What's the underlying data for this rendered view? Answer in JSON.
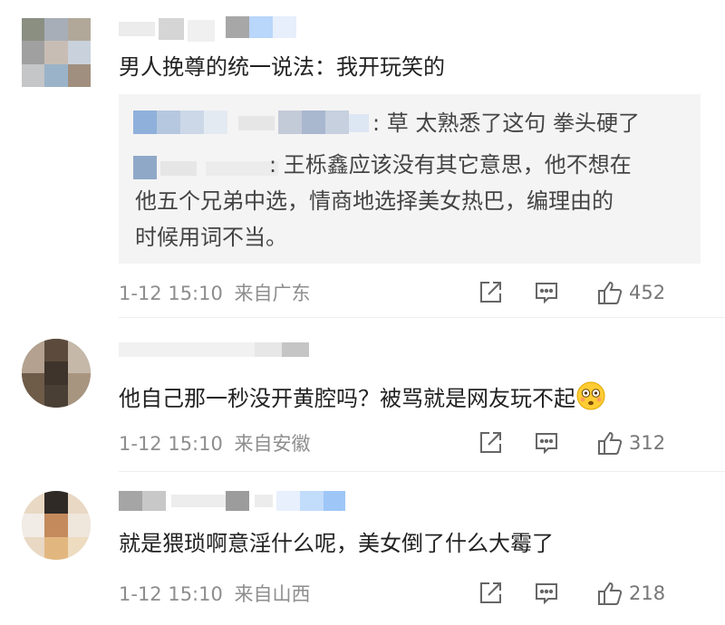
{
  "comments": [
    {
      "text": "男人挽尊的统一说法：我开玩笑的",
      "replies": [
        {
          "text": ": 草 太熟悉了这句 拳头硬了"
        },
        {
          "lines": [
            ": 王栎鑫应该没有其它意思，他不想在",
            "他五个兄弟中选，情商地选择美女热巴，编理由的",
            "时候用词不当。"
          ]
        }
      ],
      "time": "1-12 15:10",
      "location": "来自广东",
      "likes": "452"
    },
    {
      "text": "他自己那一秒没开黄腔吗？被骂就是网友玩不起",
      "emoji": "flushed-emoji",
      "time": "1-12 15:10",
      "location": "来自安徽",
      "likes": "312"
    },
    {
      "text": "就是猥琐啊意淫什么呢，美女倒了什么大霉了",
      "time": "1-12 15:10",
      "location": "来自山西",
      "likes": "218"
    }
  ],
  "icons": {
    "share": "share-icon",
    "comment": "comment-icon",
    "like": "thumbs-up-icon"
  },
  "colors": {
    "text": "#222222",
    "meta": "#8e8e8e",
    "quote_bg": "#f4f4f4",
    "icon": "#666666"
  }
}
